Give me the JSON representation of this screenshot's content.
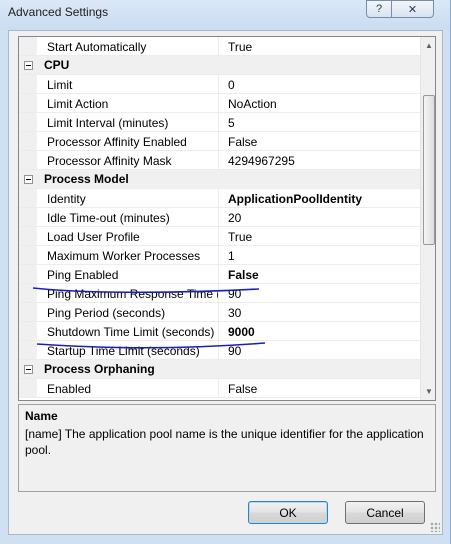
{
  "window": {
    "title": "Advanced Settings",
    "help_glyph": "?",
    "close_glyph": "✕"
  },
  "grid": {
    "rows": [
      {
        "type": "prop",
        "name": "Start Automatically",
        "value": "True",
        "bold": false
      },
      {
        "type": "category",
        "name": "CPU"
      },
      {
        "type": "prop",
        "name": "Limit",
        "value": "0",
        "bold": false
      },
      {
        "type": "prop",
        "name": "Limit Action",
        "value": "NoAction",
        "bold": false
      },
      {
        "type": "prop",
        "name": "Limit Interval (minutes)",
        "value": "5",
        "bold": false
      },
      {
        "type": "prop",
        "name": "Processor Affinity Enabled",
        "value": "False",
        "bold": false
      },
      {
        "type": "prop",
        "name": "Processor Affinity Mask",
        "value": "4294967295",
        "bold": false
      },
      {
        "type": "category",
        "name": "Process Model"
      },
      {
        "type": "prop",
        "name": "Identity",
        "value": "ApplicationPoolIdentity",
        "bold": true
      },
      {
        "type": "prop",
        "name": "Idle Time-out (minutes)",
        "value": "20",
        "bold": false
      },
      {
        "type": "prop",
        "name": "Load User Profile",
        "value": "True",
        "bold": false
      },
      {
        "type": "prop",
        "name": "Maximum Worker Processes",
        "value": "1",
        "bold": false
      },
      {
        "type": "prop",
        "name": "Ping Enabled",
        "value": "False",
        "bold": true
      },
      {
        "type": "prop",
        "name": "Ping Maximum Response Time (s",
        "value": "90",
        "bold": false
      },
      {
        "type": "prop",
        "name": "Ping Period (seconds)",
        "value": "30",
        "bold": false
      },
      {
        "type": "prop",
        "name": "Shutdown Time Limit (seconds)",
        "value": "9000",
        "bold": true
      },
      {
        "type": "prop",
        "name": "Startup Time Limit (seconds)",
        "value": "90",
        "bold": false
      },
      {
        "type": "category",
        "name": "Process Orphaning"
      },
      {
        "type": "prop",
        "name": "Enabled",
        "value": "False",
        "bold": false
      }
    ]
  },
  "description": {
    "title": "Name",
    "text": "[name] The application pool name is the unique identifier for the application pool."
  },
  "buttons": {
    "ok": "OK",
    "cancel": "Cancel"
  },
  "colors": {
    "ink": "#1a1fb8",
    "category_bg": "#f0f0f0"
  },
  "icons": {
    "collapse": "minus-box-icon",
    "scroll_up": "arrow-up-icon",
    "scroll_down": "arrow-down-icon"
  }
}
